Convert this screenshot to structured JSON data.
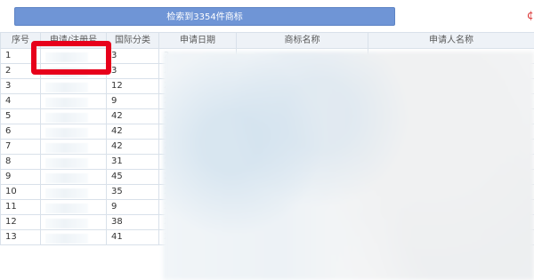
{
  "toolbar": {
    "search_result_label": "检索到3354件商标",
    "right_mark": "¢"
  },
  "table": {
    "headers": {
      "seq": "序号",
      "registration_no": "申请/注册号",
      "international_class": "国际分类",
      "application_date": "申请日期",
      "trademark_name": "商标名称",
      "applicant_name": "申请人名称"
    },
    "rows": [
      {
        "seq": "1",
        "class": "3",
        "date_stub": "2"
      },
      {
        "seq": "2",
        "class": "3",
        "date_stub": "2"
      },
      {
        "seq": "3",
        "class": "12",
        "date_stub": "2"
      },
      {
        "seq": "4",
        "class": "9",
        "date_stub": "2"
      },
      {
        "seq": "5",
        "class": "42",
        "date_stub": "2"
      },
      {
        "seq": "6",
        "class": "42",
        "date_stub": "2"
      },
      {
        "seq": "7",
        "class": "42",
        "date_stub": "2"
      },
      {
        "seq": "8",
        "class": "31",
        "date_stub": "2"
      },
      {
        "seq": "9",
        "class": "45",
        "date_stub": "2"
      },
      {
        "seq": "10",
        "class": "35",
        "date_stub": "2"
      },
      {
        "seq": "11",
        "class": "9",
        "date_stub": "2"
      },
      {
        "seq": "12",
        "class": "38",
        "date_stub": "2"
      },
      {
        "seq": "13",
        "class": "41",
        "date_stub": "2"
      }
    ]
  },
  "colors": {
    "accent": "#6f95d6",
    "highlight": "#e7001b",
    "grid": "#d9e1ea",
    "header_bg": "#eef2f7"
  }
}
